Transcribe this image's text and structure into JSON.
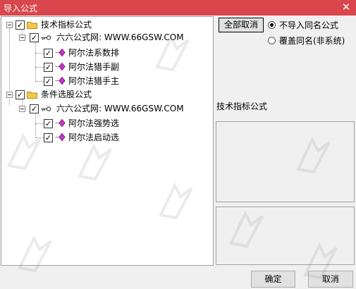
{
  "window": {
    "title": "导入公式",
    "close_glyph": "✕"
  },
  "tree": {
    "check_glyph": "✓",
    "items": [
      {
        "label": "技术指标公式",
        "level": 0,
        "type": "folder",
        "checked": true,
        "expanded": true
      },
      {
        "label": "六六公式网: WWW.66GSW.COM",
        "level": 1,
        "type": "key",
        "checked": true,
        "expanded": true
      },
      {
        "label": "阿尔法系数排",
        "level": 2,
        "type": "formula",
        "checked": true
      },
      {
        "label": "阿尔法猎手副",
        "level": 2,
        "type": "formula",
        "checked": true
      },
      {
        "label": "阿尔法猎手主",
        "level": 2,
        "type": "formula",
        "checked": true
      },
      {
        "label": "条件选股公式",
        "level": 0,
        "type": "folder",
        "checked": true,
        "expanded": true
      },
      {
        "label": "六六公式网: WWW.66GSW.COM",
        "level": 1,
        "type": "key",
        "checked": true,
        "expanded": true
      },
      {
        "label": "阿尔法强势选",
        "level": 2,
        "type": "formula",
        "checked": true
      },
      {
        "label": "阿尔法启动选",
        "level": 2,
        "type": "formula",
        "checked": true
      }
    ]
  },
  "options": {
    "cancel_all_label": "全部取消",
    "radio_no_import": "不导入同名公式",
    "radio_overwrite": "覆盖同名(非系统)",
    "selected": "radio_no_import"
  },
  "info": {
    "section_label": "技术指标公式"
  },
  "footer": {
    "ok_label": "确定",
    "cancel_label": "取消"
  },
  "colors": {
    "titlebar": "#d9464b",
    "formula_icon": "#cc33cc",
    "folder": "#f2c94c"
  }
}
